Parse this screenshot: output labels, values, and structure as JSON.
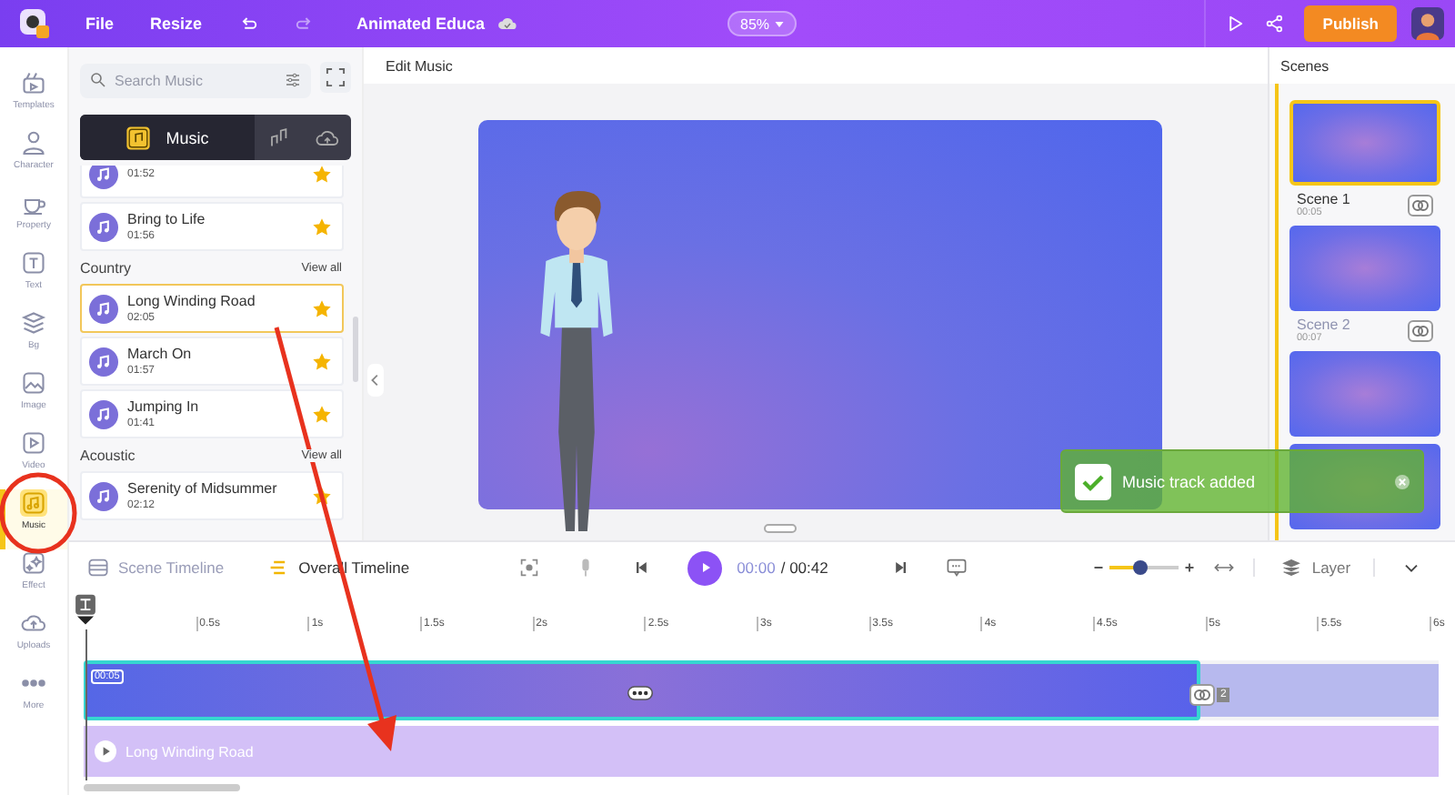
{
  "top_bar": {
    "menu": [
      "File",
      "Resize"
    ],
    "project_title": "Animated Educa",
    "zoom": "85%",
    "publish": "Publish"
  },
  "rail": [
    {
      "label": "Templates",
      "selected": false
    },
    {
      "label": "Character",
      "selected": false
    },
    {
      "label": "Property",
      "selected": false
    },
    {
      "label": "Text",
      "selected": false
    },
    {
      "label": "Bg",
      "selected": false
    },
    {
      "label": "Image",
      "selected": false
    },
    {
      "label": "Video",
      "selected": false
    },
    {
      "label": "Music",
      "selected": true
    },
    {
      "label": "Effect",
      "selected": false
    },
    {
      "label": "Uploads",
      "selected": false
    },
    {
      "label": "More",
      "selected": false
    }
  ],
  "music_panel": {
    "search_placeholder": "Search Music",
    "tabs": [
      {
        "kind": "music",
        "label": "Music",
        "selected": true
      },
      {
        "kind": "notes",
        "selected": false
      },
      {
        "kind": "cloud",
        "selected": false
      }
    ],
    "top_tracks": [
      {
        "duration": "01:52",
        "favorite": true,
        "selected": false
      },
      {
        "title": "Bring to Life",
        "duration": "01:56",
        "favorite": true,
        "selected": false
      }
    ],
    "sections": [
      {
        "title": "Country",
        "view_all": "View all",
        "tracks": [
          {
            "title": "Long Winding Road",
            "duration": "02:05",
            "favorite": true,
            "selected": true
          },
          {
            "title": "March On",
            "duration": "01:57",
            "favorite": true,
            "selected": false
          },
          {
            "title": "Jumping In",
            "duration": "01:41",
            "favorite": true,
            "selected": false
          }
        ]
      },
      {
        "title": "Acoustic",
        "view_all": "View all",
        "tracks": [
          {
            "title": "Serenity of Midsummer",
            "duration": "02:12",
            "favorite": true,
            "selected": false
          }
        ]
      }
    ]
  },
  "editor": {
    "title": "Edit Music"
  },
  "scenes_panel": {
    "title": "Scenes",
    "scenes": [
      {
        "name": "Scene 1",
        "duration": "00:05",
        "selected": true
      },
      {
        "name": "Scene 2",
        "duration": "00:07",
        "selected": false
      },
      {
        "selected": false
      },
      {
        "selected": false
      }
    ]
  },
  "toast": {
    "message": "Music track added"
  },
  "timeline": {
    "view_tabs": [
      {
        "label": "Scene Timeline",
        "selected": false
      },
      {
        "label": "Overall Timeline",
        "selected": true
      }
    ],
    "current_time": "00:00",
    "total_time": "/ 00:42",
    "zoom_slider": {
      "level": 0.45
    },
    "layer": "Layer",
    "ruler": [
      "0.5s",
      "1s",
      "1.5s",
      "2s",
      "2.5s",
      "3s",
      "3.5s",
      "4s",
      "4.5s",
      "5s",
      "5.5s",
      "6s"
    ],
    "scene_clip": {
      "time": "00:05",
      "transition_count": "2"
    },
    "music_clip": {
      "title": "Long Winding Road"
    }
  },
  "annotations": {
    "highlight_circle": true,
    "arrow": true
  }
}
